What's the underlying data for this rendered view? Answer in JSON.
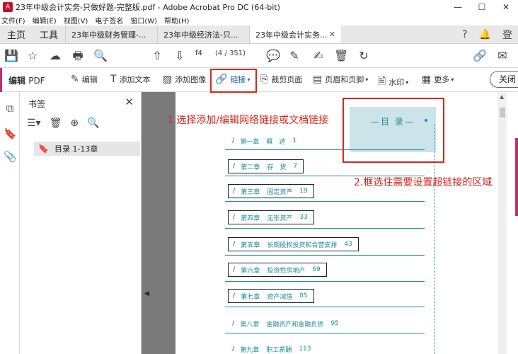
{
  "window": {
    "title": "23年中级会计实务-只做好题-完整版.pdf - Adobe Acrobat Pro DC (64-bit)",
    "minimize": "—",
    "maximize": "☐",
    "close": "✕"
  },
  "menu": [
    "文件(F)",
    "编辑(E)",
    "视图(V)",
    "电子签名",
    "窗口(W)",
    "帮助(H)"
  ],
  "tabs": {
    "home": "主页",
    "tools": "工具",
    "docs": [
      "23年中级财务管理-...",
      "23年中级经济法-只...",
      "23年中级会计实务..."
    ],
    "close_glyph": "✕"
  },
  "toolbar": {
    "page_current": "f4",
    "page_count": "(4 / 351)"
  },
  "edit_toolbar": {
    "label": "编辑",
    "label_pdf": "PDF",
    "tools": [
      "编辑",
      "添加文本",
      "添加图像",
      "链接",
      "裁剪页面",
      "页眉和页脚",
      "水印",
      "更多"
    ],
    "close_label": "关闭"
  },
  "bookmark_panel": {
    "title": "书签",
    "item": "目录 1-13章"
  },
  "document": {
    "toc_header": "—目 录—",
    "entries": [
      {
        "chapter": "第一章",
        "title": "概　述",
        "page": "1"
      },
      {
        "chapter": "第二章",
        "title": "存　货",
        "page": "7"
      },
      {
        "chapter": "第三章",
        "title": "固定资产",
        "page": "19"
      },
      {
        "chapter": "第四章",
        "title": "无形资产",
        "page": "33"
      },
      {
        "chapter": "第五章",
        "title": "长期股权投资和合营安排",
        "page": "43"
      },
      {
        "chapter": "第六章",
        "title": "投资性房地产",
        "page": "69"
      },
      {
        "chapter": "第七章",
        "title": "资产减值",
        "page": "85"
      },
      {
        "chapter": "第八章",
        "title": "金融资产和金融负债",
        "page": "95"
      },
      {
        "chapter": "第九章",
        "title": "职工薪酬",
        "page": "113"
      }
    ]
  },
  "annotations": {
    "step1": "1.选择添加/编辑网络链接或文档链接",
    "step2": "2.框选住需要设置超链接的区域"
  },
  "colors": {
    "accent": "#c1306a",
    "toc_teal": "#1b8e95",
    "annotation_red": "#d6281f",
    "link_blue": "#1a5fb4"
  }
}
